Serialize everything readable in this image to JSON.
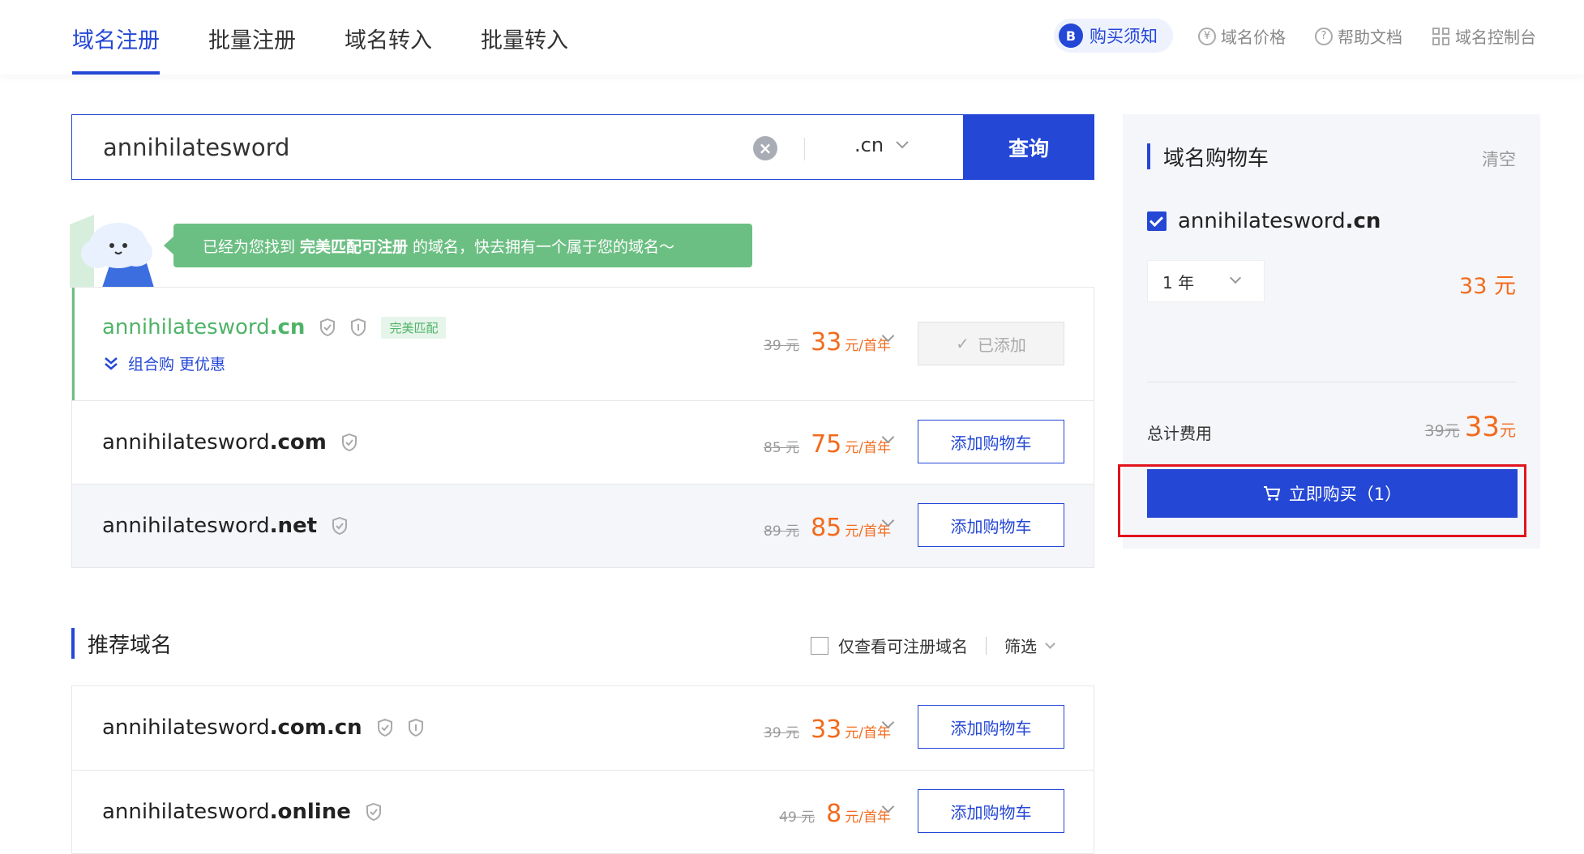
{
  "nav": {
    "tabs": [
      "域名注册",
      "批量注册",
      "域名转入",
      "批量转入"
    ],
    "active_tab": "域名注册",
    "notice_label": "购买须知",
    "notice_badge": "B",
    "links": [
      "域名价格",
      "帮助文档",
      "域名控制台"
    ]
  },
  "search": {
    "value": "annihilatesword",
    "suffix": ".cn",
    "button": "查询"
  },
  "banner": {
    "prefix": "已经为您找到",
    "highlight": "完美匹配可注册",
    "suffix": "的域名，快去拥有一个属于您的域名～"
  },
  "results": [
    {
      "base": "annihilatesword",
      "tld": ".cn",
      "old_price": "39 元",
      "price": "33",
      "unit": "元/首年",
      "action": "已添加",
      "tag": "完美匹配",
      "combo": "组合购 更优惠"
    },
    {
      "base": "annihilatesword",
      "tld": ".com",
      "old_price": "85 元",
      "price": "75",
      "unit": "元/首年",
      "action": "添加购物车"
    },
    {
      "base": "annihilatesword",
      "tld": ".net",
      "old_price": "89 元",
      "price": "85",
      "unit": "元/首年",
      "action": "添加购物车"
    }
  ],
  "recommend": {
    "title": "推荐域名",
    "filter_checkbox": "仅查看可注册域名",
    "filter": "筛选",
    "items": [
      {
        "base": "annihilatesword",
        "tld": ".com.cn",
        "old_price": "39 元",
        "price": "33",
        "unit": "元/首年",
        "action": "添加购物车"
      },
      {
        "base": "annihilatesword",
        "tld": ".online",
        "old_price": "49 元",
        "price": "8",
        "unit": "元/首年",
        "action": "添加购物车"
      }
    ]
  },
  "cart": {
    "title": "域名购物车",
    "clear": "清空",
    "item_base": "annihilatesword",
    "item_tld": ".cn",
    "year": "1 年",
    "item_price": "33 元",
    "total_label": "总计费用",
    "total_old": "39元",
    "total_price": "33",
    "total_unit": "元",
    "buy_button": "立即购买（1）"
  },
  "colors": {
    "primary": "#2447d6",
    "price": "#f26b1d",
    "success": "#4fb368",
    "highlight": "#e1141e"
  }
}
